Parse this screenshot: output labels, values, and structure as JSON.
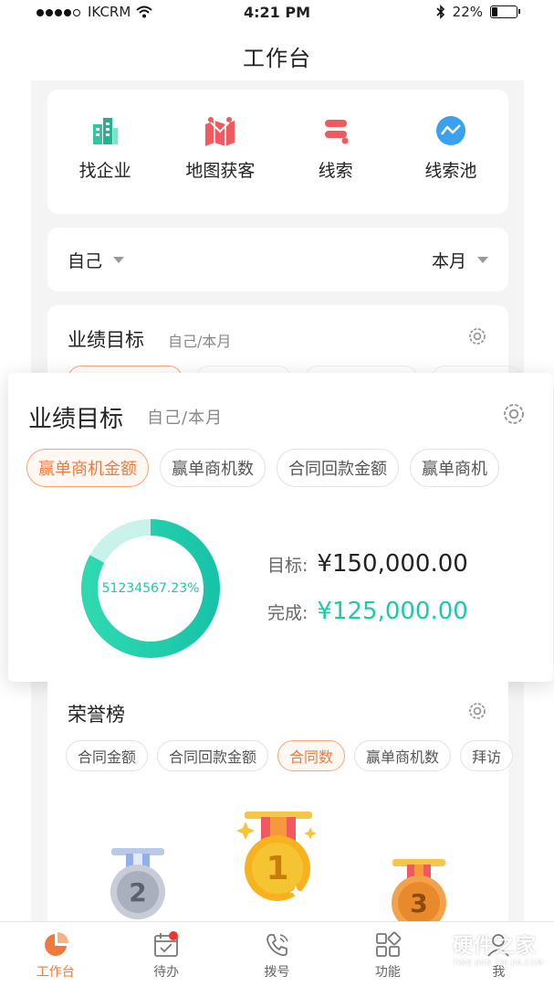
{
  "status_bar": {
    "carrier": "IKCRM",
    "time": "4:21 PM",
    "battery": "22%",
    "battery_level": 0.22
  },
  "nav": {
    "title": "工作台"
  },
  "quick_actions": [
    {
      "label": "找企业",
      "icon": "building-icon"
    },
    {
      "label": "地图获客",
      "icon": "map-icon"
    },
    {
      "label": "线索",
      "icon": "leads-icon"
    },
    {
      "label": "线索池",
      "icon": "leads-pool-icon"
    }
  ],
  "filter": {
    "scope": "自己",
    "period": "本月"
  },
  "performance": {
    "title": "业绩目标",
    "subtitle": "自己/本月",
    "tabs": [
      "赢单商机金额",
      "赢单商机数",
      "合同回款金额",
      "赢单商机"
    ],
    "active_tab": 0,
    "progress_text": "51234567.23%",
    "progress_fraction": 0.83,
    "target_label": "目标:",
    "target_value": "¥150,000.00",
    "done_label": "完成:",
    "done_value": "¥125,000.00",
    "accent": "#1ec9a6"
  },
  "honor": {
    "title": "荣誉榜",
    "tabs": [
      "合同金额",
      "合同回款金额",
      "合同数",
      "赢单商机数",
      "拜访"
    ],
    "active_tab": 2,
    "ranks": [
      "2",
      "1",
      "3"
    ]
  },
  "tabbar": [
    {
      "label": "工作台",
      "icon": "dashboard-icon",
      "active": true
    },
    {
      "label": "待办",
      "icon": "calendar-todo-icon",
      "badge": true
    },
    {
      "label": "拨号",
      "icon": "phone-icon"
    },
    {
      "label": "功能",
      "icon": "apps-icon"
    },
    {
      "label": "我",
      "icon": "profile-icon"
    }
  ],
  "watermark": {
    "title": "硬件之家",
    "subtitle": "YING JIAN ZHI JIA.COM"
  },
  "colors": {
    "orange": "#f07a3c",
    "green": "#1ec9a6",
    "red": "#f2352b"
  }
}
